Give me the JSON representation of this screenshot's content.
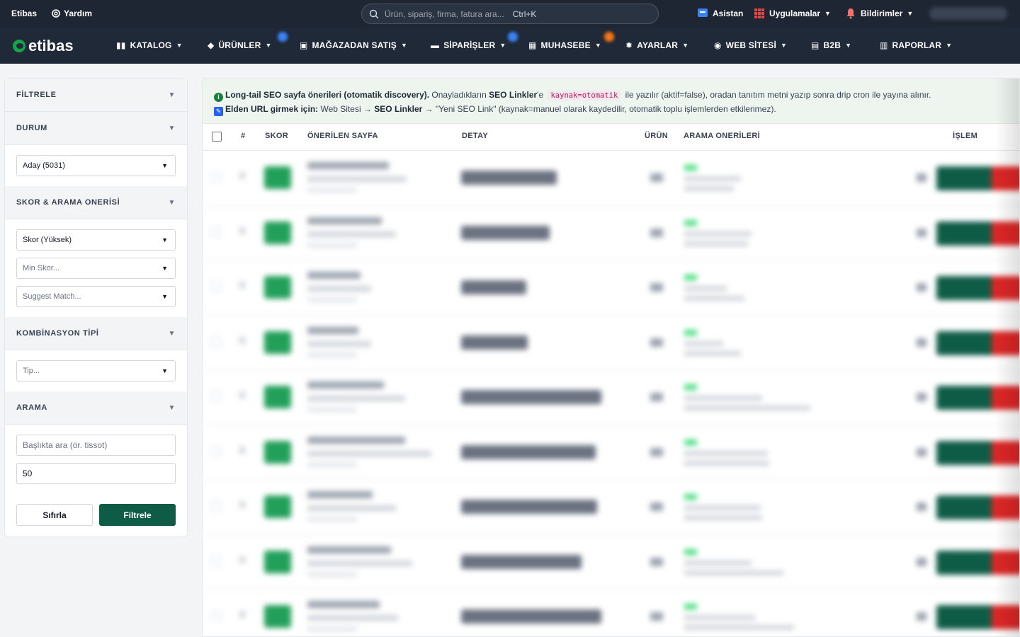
{
  "topbar": {
    "brand": "Etibas",
    "help": "Yardım",
    "search_placeholder": "Ürün, sipariş, firma, fatura ara...",
    "search_shortcut": "Ctrl+K",
    "assistant": "Asistan",
    "apps": "Uygulamalar",
    "notifications": "Bildirimler"
  },
  "nav": {
    "logo": "etibas",
    "items": [
      "KATALOG",
      "ÜRÜNLER",
      "MAĞAZADAN SATIŞ",
      "SİPARİŞLER",
      "MUHASEBE",
      "AYARLAR",
      "WEB SİTESİ",
      "B2B",
      "RAPORLAR"
    ]
  },
  "sidebar": {
    "sections": {
      "filter": "FİLTRELE",
      "status": "DURUM",
      "score": "SKOR & ARAMA ONERİSİ",
      "combo": "KOMBİNASYON TİPİ",
      "search": "ARAMA"
    },
    "status_value": "Aday (5031)",
    "score_sort": "Skor (Yüksek)",
    "min_score": "Min Skor...",
    "suggest_match": "Suggest Match...",
    "type": "Tip...",
    "title_placeholder": "Başlıkta ara (ör. tissot)",
    "limit_value": "50",
    "reset": "Sıfırla",
    "filter": "Filtrele"
  },
  "info": {
    "line1_bold": "Long-tail SEO sayfa önerileri (otomatik discovery).",
    "line1_a": "Onayladıkların",
    "line1_b": "SEO Linkler",
    "line1_c": "'e",
    "line1_code": "kaynak=otomatik",
    "line1_d": "ile yazılır (aktif=false), oradan tanıtım metni yazıp sonra drip cron ile yayına alınır.",
    "line2_bold": "Elden URL girmek için:",
    "line2_a": "Web Sitesi →",
    "line2_b": "SEO Linkler",
    "line2_c": "→ \"Yeni SEO Link\" (kaynak=manuel olarak kaydedilir, otomatik toplu işlemlerden etkilenmez)."
  },
  "table": {
    "headers": {
      "num": "#",
      "score": "SKOR",
      "page": "ÖNERİLEN SAYFA",
      "detail": "DETAY",
      "product": "ÜRÜN",
      "suggestions": "ARAMA ONERİLERİ",
      "action": "İŞLEM"
    }
  },
  "colors": {
    "topbar": "#1e2633",
    "nav": "#1f2937",
    "primary": "#0f5c46",
    "score": "#22a05a",
    "danger": "#dc2626"
  }
}
